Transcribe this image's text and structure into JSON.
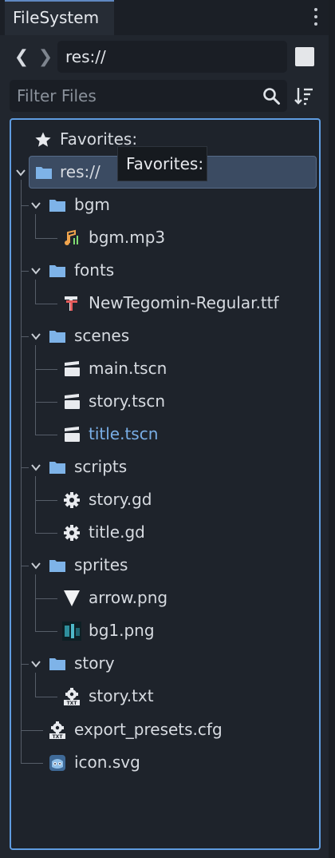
{
  "tab": {
    "title": "FileSystem"
  },
  "nav": {
    "back": "❮",
    "forward": "❯",
    "path": "res://"
  },
  "filter": {
    "placeholder": "Filter Files"
  },
  "tooltip": {
    "text": "Favorites:"
  },
  "tree": {
    "favorites": "Favorites:",
    "root": "res://",
    "bgm": "bgm",
    "bgm_mp3": "bgm.mp3",
    "fonts": "fonts",
    "font_file": "NewTegomin-Regular.ttf",
    "scenes": "scenes",
    "main_tscn": "main.tscn",
    "story_tscn": "story.tscn",
    "title_tscn": "title.tscn",
    "scripts": "scripts",
    "story_gd": "story.gd",
    "title_gd": "title.gd",
    "sprites": "sprites",
    "arrow_png": "arrow.png",
    "bg1_png": "bg1.png",
    "story": "story",
    "story_txt": "story.txt",
    "export_presets": "export_presets.cfg",
    "icon_svg": "icon.svg"
  },
  "colors": {
    "folder": "#7eb3e8",
    "accent_border": "#5f9ce0",
    "selected_row": "#3b4b62",
    "highlight_text": "#79aee6"
  }
}
